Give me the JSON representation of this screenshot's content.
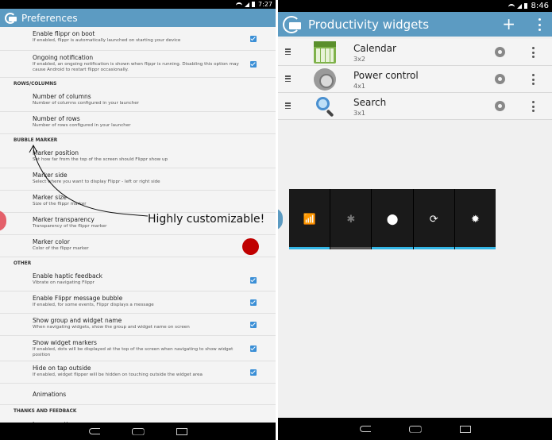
{
  "left": {
    "status_time": "7:27",
    "title": "Preferences",
    "annotation": "Highly customizable!",
    "items": [
      {
        "type": "pref",
        "title": "Enable flippr on boot",
        "summary": "If enabled, flippr is automatically launched on starting your device",
        "control": "checkbox"
      },
      {
        "type": "pref",
        "title": "Ongoing notification",
        "summary": "If enabled, an ongoing notification is shown when flippr is running. Disabling this option may cause Android to restart flippr occasionally.",
        "control": "checkbox"
      },
      {
        "type": "category",
        "title": "ROWS/COLUMNS"
      },
      {
        "type": "pref",
        "title": "Number of columns",
        "summary": "Number of columns configured in your launcher"
      },
      {
        "type": "pref",
        "title": "Number of rows",
        "summary": "Number of rows configured in your launcher"
      },
      {
        "type": "category",
        "title": "BUBBLE MARKER"
      },
      {
        "type": "pref",
        "title": "Marker position",
        "summary": "Set how far from the top of the screen should Flippr show up"
      },
      {
        "type": "pref",
        "title": "Marker side",
        "summary": "Select where you want to display Flippr - left or right side"
      },
      {
        "type": "pref",
        "title": "Marker size",
        "summary": "Size of the flippr marker"
      },
      {
        "type": "pref",
        "title": "Marker transparency",
        "summary": "Transparency of the flippr marker"
      },
      {
        "type": "pref",
        "title": "Marker color",
        "summary": "Color of the flippr marker",
        "control": "color"
      },
      {
        "type": "category",
        "title": "OTHER"
      },
      {
        "type": "pref",
        "title": "Enable haptic feedback",
        "summary": "Vibrate on navigating Flippr",
        "control": "checkbox"
      },
      {
        "type": "pref",
        "title": "Enable Flippr message bubble",
        "summary": "If enabled, for some events, Flippr displays a message",
        "control": "checkbox"
      },
      {
        "type": "pref",
        "title": "Show group and widget name",
        "summary": "When navigating widgets, show the group and widget name on screen",
        "control": "checkbox"
      },
      {
        "type": "pref",
        "title": "Show widget markers",
        "summary": "If enabled, dots will be displayed at the top of the screen when navigating to show widget position",
        "control": "checkbox"
      },
      {
        "type": "pref",
        "title": "Hide on tap outside",
        "summary": "If enabled, widget flipper will be hidden on touching outside the widget area",
        "control": "checkbox"
      },
      {
        "type": "pref",
        "title": "Animations",
        "summary": ""
      },
      {
        "type": "category",
        "title": "THANKS AND FEEDBACK"
      },
      {
        "type": "pref",
        "title": "Leave a rating",
        "summary": ""
      }
    ],
    "marker_color": "#c00000",
    "accent": "#3b8fd6"
  },
  "right": {
    "status_time": "8:46",
    "title": "Productivity widgets",
    "add_icon": "plus-icon",
    "widgets": [
      {
        "name": "Calendar",
        "size": "3x2",
        "icon": "calendar-icon"
      },
      {
        "name": "Power control",
        "size": "4x1",
        "icon": "power-control-icon"
      },
      {
        "name": "Search",
        "size": "3x1",
        "icon": "search-icon"
      }
    ],
    "power_widget": [
      {
        "icon": "wifi-icon",
        "glyph": "📶",
        "on": true
      },
      {
        "icon": "bluetooth-icon",
        "glyph": "✱",
        "on": false
      },
      {
        "icon": "location-icon",
        "glyph": "⬤",
        "on": true
      },
      {
        "icon": "sync-icon",
        "glyph": "⟳",
        "on": true
      },
      {
        "icon": "brightness-icon",
        "glyph": "✹",
        "on": true
      }
    ],
    "brand_color": "#5c9bc2",
    "active_color": "#33b5e5"
  }
}
